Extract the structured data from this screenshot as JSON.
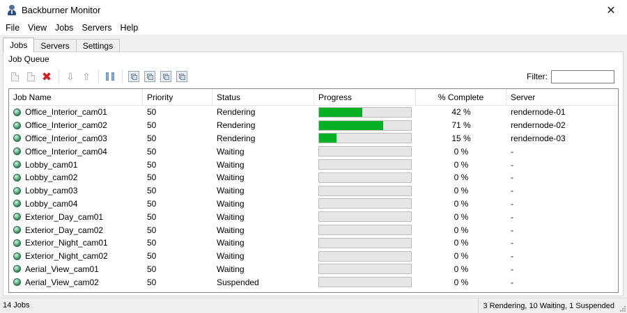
{
  "window": {
    "title": "Backburner Monitor",
    "icon": "user-icon"
  },
  "menu": [
    "File",
    "View",
    "Jobs",
    "Servers",
    "Help"
  ],
  "tabs": [
    "Jobs",
    "Servers",
    "Settings"
  ],
  "group": {
    "title": "Job Queue"
  },
  "toolbar": {
    "icons": [
      "new-job-icon",
      "copy-job-icon",
      "delete-icon",
      "move-down-icon",
      "move-up-icon",
      "pause-icon",
      "server-assign-icon",
      "server-remove-icon",
      "server-up-icon",
      "server-down-icon"
    ]
  },
  "filter": {
    "label": "Filter:",
    "value": ""
  },
  "columns": [
    "Job Name",
    "Priority",
    "Status",
    "Progress",
    "% Complete",
    "Server"
  ],
  "jobs": [
    {
      "name": "Office_Interior_cam01",
      "priority": "50",
      "status": "Rendering",
      "progress": 0.47,
      "pct": "42 %",
      "server": "rendernode-01"
    },
    {
      "name": "Office_Interior_cam02",
      "priority": "50",
      "status": "Rendering",
      "progress": 0.7,
      "pct": "71 %",
      "server": "rendernode-02"
    },
    {
      "name": "Office_Interior_cam03",
      "priority": "50",
      "status": "Rendering",
      "progress": 0.19,
      "pct": "15 %",
      "server": "rendernode-03"
    },
    {
      "name": "Office_Interior_cam04",
      "priority": "50",
      "status": "Waiting",
      "progress": 0,
      "pct": "0 %",
      "server": "-"
    },
    {
      "name": "Lobby_cam01",
      "priority": "50",
      "status": "Waiting",
      "progress": 0,
      "pct": "0 %",
      "server": "-"
    },
    {
      "name": "Lobby_cam02",
      "priority": "50",
      "status": "Waiting",
      "progress": 0,
      "pct": "0 %",
      "server": "-"
    },
    {
      "name": "Lobby_cam03",
      "priority": "50",
      "status": "Waiting",
      "progress": 0,
      "pct": "0 %",
      "server": "-"
    },
    {
      "name": "Lobby_cam04",
      "priority": "50",
      "status": "Waiting",
      "progress": 0,
      "pct": "0 %",
      "server": "-"
    },
    {
      "name": "Exterior_Day_cam01",
      "priority": "50",
      "status": "Waiting",
      "progress": 0,
      "pct": "0 %",
      "server": "-"
    },
    {
      "name": "Exterior_Day_cam02",
      "priority": "50",
      "status": "Waiting",
      "progress": 0,
      "pct": "0 %",
      "server": "-"
    },
    {
      "name": "Exterior_Night_cam01",
      "priority": "50",
      "status": "Waiting",
      "progress": 0,
      "pct": "0 %",
      "server": "-"
    },
    {
      "name": "Exterior_Night_cam02",
      "priority": "50",
      "status": "Waiting",
      "progress": 0,
      "pct": "0 %",
      "server": "-"
    },
    {
      "name": "Aerial_View_cam01",
      "priority": "50",
      "status": "Waiting",
      "progress": 0,
      "pct": "0 %",
      "server": "-"
    },
    {
      "name": "Aerial_View_cam02",
      "priority": "50",
      "status": "Suspended",
      "progress": 0,
      "pct": "0 %",
      "server": "-"
    }
  ],
  "statusbar": {
    "left": "14 Jobs",
    "right": "3 Rendering, 10 Waiting, 1 Suspended"
  },
  "colors": {
    "progress_fill": "#06b025",
    "delete": "#d42020"
  }
}
